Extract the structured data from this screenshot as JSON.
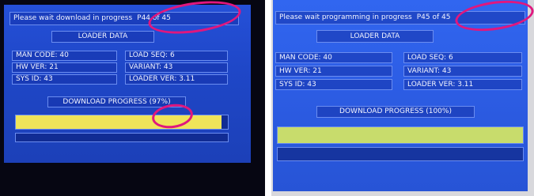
{
  "left_screen": {
    "status_text": "Please wait download in progress",
    "page_indicator": "P44 of 45",
    "loader_title": "LOADER DATA",
    "man_code": "MAN CODE: 40",
    "hw_ver": "HW VER: 21",
    "sys_id": "SYS ID: 43",
    "load_seq": "LOAD SEQ: 6",
    "variant": "VARIANT: 43",
    "loader_ver": "LOADER VER: 3.11",
    "progress_label": "DOWNLOAD PROGRESS (97%)",
    "progress_fraction": 0.97
  },
  "right_screen": {
    "status_text": "Please wait programming in progress",
    "page_indicator": "P45 of 45",
    "loader_title": "LOADER DATA",
    "man_code": "MAN CODE: 40",
    "hw_ver": "HW VER: 21",
    "sys_id": "SYS ID: 43",
    "load_seq": "LOAD SEQ: 6",
    "variant": "VARIANT: 43",
    "loader_ver": "LOADER VER: 3.11",
    "progress_label": "DOWNLOAD PROGRESS (100%)",
    "progress_fraction": 1.0
  },
  "colors": {
    "screen_blue": "#2550d8",
    "panel_border": "#6b8df0",
    "progress_yellow": "#efe45a",
    "progress_green": "#c8dc6c",
    "annotation_pink": "#e0177e"
  }
}
